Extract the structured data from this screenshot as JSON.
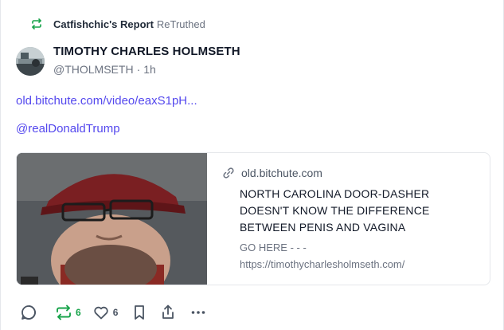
{
  "retruth": {
    "user": "Catfishchic's Report",
    "verb": "ReTruthed"
  },
  "author": {
    "name": "TIMOTHY CHARLES HOLMSETH",
    "handle": "@THOLMSETH",
    "time": "1h"
  },
  "post": {
    "link": "old.bitchute.com/video/eaxS1pH...",
    "mention": "@realDonaldTrump"
  },
  "card": {
    "domain": "old.bitchute.com",
    "title": "NORTH CAROLINA DOOR-DASHER DOESN'T KNOW THE DIFFERENCE BETWEEN PENIS AND VAGINA",
    "description_line1": "GO HERE - - -",
    "description_line2": "https://timothycharlesholmseth.com/"
  },
  "actions": {
    "retruth_count": "6",
    "like_count": "6"
  },
  "colors": {
    "accent": "#5448ee",
    "retruth_green": "#17a34a",
    "muted": "#6b7280"
  }
}
